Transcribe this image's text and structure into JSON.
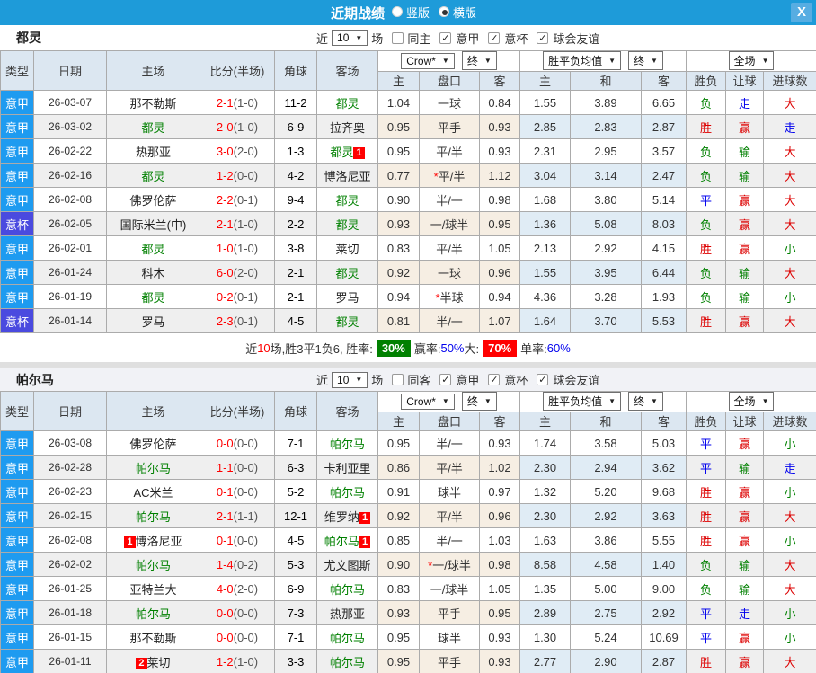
{
  "titlebar": {
    "title": "近期战绩",
    "radios": [
      {
        "label": "竖版",
        "checked": false
      },
      {
        "label": "横版",
        "checked": true
      }
    ],
    "close_label": "X"
  },
  "colors": {
    "titlebar_bg": "#1E9BD9",
    "league_badge": "#1E9BF0",
    "cup_badge": "#4A4ADF",
    "self_team": "#008000",
    "win": "#DD0000",
    "draw": "#0000EE",
    "loss": "#008000",
    "win_rate_bg": "#008000",
    "big_rate_bg": "#FF0000"
  },
  "table_headers": {
    "cols": [
      "类型",
      "日期",
      "主场",
      "比分(半场)",
      "角球",
      "客场"
    ],
    "sub_odds": [
      "主",
      "盘口",
      "客"
    ],
    "sub_mean": [
      "主",
      "和",
      "客"
    ],
    "sub_result": [
      "胜负",
      "让球",
      "进球数"
    ]
  },
  "sections": [
    {
      "team": "都灵",
      "filter": {
        "prefix": "近",
        "count": "10",
        "suffix": "场",
        "same_label": "同主",
        "same_checked": false,
        "competitions": [
          {
            "label": "意甲",
            "checked": true
          },
          {
            "label": "意杯",
            "checked": true
          },
          {
            "label": "球会友谊",
            "checked": true
          }
        ]
      },
      "dropdowns": {
        "company": "Crow*",
        "company_state": "终",
        "mean": "胜平负均值",
        "mean_state": "终",
        "scope": "全场"
      },
      "rows": [
        {
          "t": "意甲",
          "tc": "league",
          "d": "26-03-07",
          "hp": "",
          "h": "那不勒斯",
          "hs": false,
          "hb": "",
          "s": "2-1",
          "sh": "(1-0)",
          "ck": "11-2",
          "ap": "",
          "a": "都灵",
          "as": true,
          "ab": "",
          "o1": "1.04",
          "st": false,
          "hc": "一球",
          "o2": "0.84",
          "m1": "1.55",
          "m2": "3.89",
          "m3": "6.65",
          "r": [
            "负",
            "g"
          ],
          "l": [
            "走",
            "b"
          ],
          "g": [
            "大",
            "r"
          ]
        },
        {
          "t": "意甲",
          "tc": "league",
          "d": "26-03-02",
          "hp": "",
          "h": "都灵",
          "hs": true,
          "hb": "",
          "s": "2-0",
          "sh": "(1-0)",
          "ck": "6-9",
          "ap": "",
          "a": "拉齐奥",
          "as": false,
          "ab": "",
          "o1": "0.95",
          "st": false,
          "hc": "平手",
          "o2": "0.93",
          "m1": "2.85",
          "m2": "2.83",
          "m3": "2.87",
          "r": [
            "胜",
            "r"
          ],
          "l": [
            "赢",
            "r"
          ],
          "g": [
            "走",
            "b"
          ]
        },
        {
          "t": "意甲",
          "tc": "league",
          "d": "26-02-22",
          "hp": "",
          "h": "热那亚",
          "hs": false,
          "hb": "",
          "s": "3-0",
          "sh": "(2-0)",
          "ck": "1-3",
          "ap": "",
          "a": "都灵",
          "as": true,
          "ab": "1",
          "o1": "0.95",
          "st": false,
          "hc": "平/半",
          "o2": "0.93",
          "m1": "2.31",
          "m2": "2.95",
          "m3": "3.57",
          "r": [
            "负",
            "g"
          ],
          "l": [
            "输",
            "g"
          ],
          "g": [
            "大",
            "r"
          ]
        },
        {
          "t": "意甲",
          "tc": "league",
          "d": "26-02-16",
          "hp": "",
          "h": "都灵",
          "hs": true,
          "hb": "",
          "s": "1-2",
          "sh": "(0-0)",
          "ck": "4-2",
          "ap": "",
          "a": "博洛尼亚",
          "as": false,
          "ab": "",
          "o1": "0.77",
          "st": true,
          "hc": "平/半",
          "o2": "1.12",
          "m1": "3.04",
          "m2": "3.14",
          "m3": "2.47",
          "r": [
            "负",
            "g"
          ],
          "l": [
            "输",
            "g"
          ],
          "g": [
            "大",
            "r"
          ]
        },
        {
          "t": "意甲",
          "tc": "league",
          "d": "26-02-08",
          "hp": "",
          "h": "佛罗伦萨",
          "hs": false,
          "hb": "",
          "s": "2-2",
          "sh": "(0-1)",
          "ck": "9-4",
          "ap": "",
          "a": "都灵",
          "as": true,
          "ab": "",
          "o1": "0.90",
          "st": false,
          "hc": "半/一",
          "o2": "0.98",
          "m1": "1.68",
          "m2": "3.80",
          "m3": "5.14",
          "r": [
            "平",
            "b"
          ],
          "l": [
            "赢",
            "r"
          ],
          "g": [
            "大",
            "r"
          ]
        },
        {
          "t": "意杯",
          "tc": "cup",
          "d": "26-02-05",
          "hp": "",
          "h": "国际米兰(中)",
          "hs": false,
          "hb": "",
          "s": "2-1",
          "sh": "(1-0)",
          "ck": "2-2",
          "ap": "",
          "a": "都灵",
          "as": true,
          "ab": "",
          "o1": "0.93",
          "st": false,
          "hc": "一/球半",
          "o2": "0.95",
          "m1": "1.36",
          "m2": "5.08",
          "m3": "8.03",
          "r": [
            "负",
            "g"
          ],
          "l": [
            "赢",
            "r"
          ],
          "g": [
            "大",
            "r"
          ]
        },
        {
          "t": "意甲",
          "tc": "league",
          "d": "26-02-01",
          "hp": "",
          "h": "都灵",
          "hs": true,
          "hb": "",
          "s": "1-0",
          "sh": "(1-0)",
          "ck": "3-8",
          "ap": "",
          "a": "莱切",
          "as": false,
          "ab": "",
          "o1": "0.83",
          "st": false,
          "hc": "平/半",
          "o2": "1.05",
          "m1": "2.13",
          "m2": "2.92",
          "m3": "4.15",
          "r": [
            "胜",
            "r"
          ],
          "l": [
            "赢",
            "r"
          ],
          "g": [
            "小",
            "g"
          ]
        },
        {
          "t": "意甲",
          "tc": "league",
          "d": "26-01-24",
          "hp": "",
          "h": "科木",
          "hs": false,
          "hb": "",
          "s": "6-0",
          "sh": "(2-0)",
          "ck": "2-1",
          "ap": "",
          "a": "都灵",
          "as": true,
          "ab": "",
          "o1": "0.92",
          "st": false,
          "hc": "一球",
          "o2": "0.96",
          "m1": "1.55",
          "m2": "3.95",
          "m3": "6.44",
          "r": [
            "负",
            "g"
          ],
          "l": [
            "输",
            "g"
          ],
          "g": [
            "大",
            "r"
          ]
        },
        {
          "t": "意甲",
          "tc": "league",
          "d": "26-01-19",
          "hp": "",
          "h": "都灵",
          "hs": true,
          "hb": "",
          "s": "0-2",
          "sh": "(0-1)",
          "ck": "2-1",
          "ap": "",
          "a": "罗马",
          "as": false,
          "ab": "",
          "o1": "0.94",
          "st": true,
          "hc": "半球",
          "o2": "0.94",
          "m1": "4.36",
          "m2": "3.28",
          "m3": "1.93",
          "r": [
            "负",
            "g"
          ],
          "l": [
            "输",
            "g"
          ],
          "g": [
            "小",
            "g"
          ]
        },
        {
          "t": "意杯",
          "tc": "cup",
          "d": "26-01-14",
          "hp": "",
          "h": "罗马",
          "hs": false,
          "hb": "",
          "s": "2-3",
          "sh": "(0-1)",
          "ck": "4-5",
          "ap": "",
          "a": "都灵",
          "as": true,
          "ab": "",
          "o1": "0.81",
          "st": false,
          "hc": "半/一",
          "o2": "1.07",
          "m1": "1.64",
          "m2": "3.70",
          "m3": "5.53",
          "r": [
            "胜",
            "r"
          ],
          "l": [
            "赢",
            "r"
          ],
          "g": [
            "大",
            "r"
          ]
        }
      ],
      "summary": [
        {
          "t": "近",
          "c": "k"
        },
        {
          "t": "10",
          "c": "r"
        },
        {
          "t": "场,胜3平1负6, 胜率:",
          "c": "k"
        },
        {
          "t": "30%",
          "c": "wg"
        },
        {
          "t": "赢率:",
          "c": "k"
        },
        {
          "t": "50%",
          "c": "b"
        },
        {
          "t": " 大:",
          "c": "k"
        },
        {
          "t": "70%",
          "c": "wr"
        },
        {
          "t": "单率:",
          "c": "k"
        },
        {
          "t": "60%",
          "c": "b"
        }
      ]
    },
    {
      "team": "帕尔马",
      "filter": {
        "prefix": "近",
        "count": "10",
        "suffix": "场",
        "same_label": "同客",
        "same_checked": false,
        "competitions": [
          {
            "label": "意甲",
            "checked": true
          },
          {
            "label": "意杯",
            "checked": true
          },
          {
            "label": "球会友谊",
            "checked": true
          }
        ]
      },
      "dropdowns": {
        "company": "Crow*",
        "company_state": "终",
        "mean": "胜平负均值",
        "mean_state": "终",
        "scope": "全场"
      },
      "rows": [
        {
          "t": "意甲",
          "tc": "league",
          "d": "26-03-08",
          "hp": "",
          "h": "佛罗伦萨",
          "hs": false,
          "hb": "",
          "s": "0-0",
          "sh": "(0-0)",
          "ck": "7-1",
          "ap": "",
          "a": "帕尔马",
          "as": true,
          "ab": "",
          "o1": "0.95",
          "st": false,
          "hc": "半/一",
          "o2": "0.93",
          "m1": "1.74",
          "m2": "3.58",
          "m3": "5.03",
          "r": [
            "平",
            "b"
          ],
          "l": [
            "赢",
            "r"
          ],
          "g": [
            "小",
            "g"
          ]
        },
        {
          "t": "意甲",
          "tc": "league",
          "d": "26-02-28",
          "hp": "",
          "h": "帕尔马",
          "hs": true,
          "hb": "",
          "s": "1-1",
          "sh": "(0-0)",
          "ck": "6-3",
          "ap": "",
          "a": "卡利亚里",
          "as": false,
          "ab": "",
          "o1": "0.86",
          "st": false,
          "hc": "平/半",
          "o2": "1.02",
          "m1": "2.30",
          "m2": "2.94",
          "m3": "3.62",
          "r": [
            "平",
            "b"
          ],
          "l": [
            "输",
            "g"
          ],
          "g": [
            "走",
            "b"
          ]
        },
        {
          "t": "意甲",
          "tc": "league",
          "d": "26-02-23",
          "hp": "",
          "h": "AC米兰",
          "hs": false,
          "hb": "",
          "s": "0-1",
          "sh": "(0-0)",
          "ck": "5-2",
          "ap": "",
          "a": "帕尔马",
          "as": true,
          "ab": "",
          "o1": "0.91",
          "st": false,
          "hc": "球半",
          "o2": "0.97",
          "m1": "1.32",
          "m2": "5.20",
          "m3": "9.68",
          "r": [
            "胜",
            "r"
          ],
          "l": [
            "赢",
            "r"
          ],
          "g": [
            "小",
            "g"
          ]
        },
        {
          "t": "意甲",
          "tc": "league",
          "d": "26-02-15",
          "hp": "",
          "h": "帕尔马",
          "hs": true,
          "hb": "",
          "s": "2-1",
          "sh": "(1-1)",
          "ck": "12-1",
          "ap": "",
          "a": "维罗纳",
          "as": false,
          "ab": "1",
          "o1": "0.92",
          "st": false,
          "hc": "平/半",
          "o2": "0.96",
          "m1": "2.30",
          "m2": "2.92",
          "m3": "3.63",
          "r": [
            "胜",
            "r"
          ],
          "l": [
            "赢",
            "r"
          ],
          "g": [
            "大",
            "r"
          ]
        },
        {
          "t": "意甲",
          "tc": "league",
          "d": "26-02-08",
          "hp": "1",
          "h": "博洛尼亚",
          "hs": false,
          "hb": "",
          "s": "0-1",
          "sh": "(0-0)",
          "ck": "4-5",
          "ap": "",
          "a": "帕尔马",
          "as": true,
          "ab": "1",
          "o1": "0.85",
          "st": false,
          "hc": "半/一",
          "o2": "1.03",
          "m1": "1.63",
          "m2": "3.86",
          "m3": "5.55",
          "r": [
            "胜",
            "r"
          ],
          "l": [
            "赢",
            "r"
          ],
          "g": [
            "小",
            "g"
          ]
        },
        {
          "t": "意甲",
          "tc": "league",
          "d": "26-02-02",
          "hp": "",
          "h": "帕尔马",
          "hs": true,
          "hb": "",
          "s": "1-4",
          "sh": "(0-2)",
          "ck": "5-3",
          "ap": "",
          "a": "尤文图斯",
          "as": false,
          "ab": "",
          "o1": "0.90",
          "st": true,
          "hc": "一/球半",
          "o2": "0.98",
          "m1": "8.58",
          "m2": "4.58",
          "m3": "1.40",
          "r": [
            "负",
            "g"
          ],
          "l": [
            "输",
            "g"
          ],
          "g": [
            "大",
            "r"
          ]
        },
        {
          "t": "意甲",
          "tc": "league",
          "d": "26-01-25",
          "hp": "",
          "h": "亚特兰大",
          "hs": false,
          "hb": "",
          "s": "4-0",
          "sh": "(2-0)",
          "ck": "6-9",
          "ap": "",
          "a": "帕尔马",
          "as": true,
          "ab": "",
          "o1": "0.83",
          "st": false,
          "hc": "一/球半",
          "o2": "1.05",
          "m1": "1.35",
          "m2": "5.00",
          "m3": "9.00",
          "r": [
            "负",
            "g"
          ],
          "l": [
            "输",
            "g"
          ],
          "g": [
            "大",
            "r"
          ]
        },
        {
          "t": "意甲",
          "tc": "league",
          "d": "26-01-18",
          "hp": "",
          "h": "帕尔马",
          "hs": true,
          "hb": "",
          "s": "0-0",
          "sh": "(0-0)",
          "ck": "7-3",
          "ap": "",
          "a": "热那亚",
          "as": false,
          "ab": "",
          "o1": "0.93",
          "st": false,
          "hc": "平手",
          "o2": "0.95",
          "m1": "2.89",
          "m2": "2.75",
          "m3": "2.92",
          "r": [
            "平",
            "b"
          ],
          "l": [
            "走",
            "b"
          ],
          "g": [
            "小",
            "g"
          ]
        },
        {
          "t": "意甲",
          "tc": "league",
          "d": "26-01-15",
          "hp": "",
          "h": "那不勒斯",
          "hs": false,
          "hb": "",
          "s": "0-0",
          "sh": "(0-0)",
          "ck": "7-1",
          "ap": "",
          "a": "帕尔马",
          "as": true,
          "ab": "",
          "o1": "0.95",
          "st": false,
          "hc": "球半",
          "o2": "0.93",
          "m1": "1.30",
          "m2": "5.24",
          "m3": "10.69",
          "r": [
            "平",
            "b"
          ],
          "l": [
            "赢",
            "r"
          ],
          "g": [
            "小",
            "g"
          ]
        },
        {
          "t": "意甲",
          "tc": "league",
          "d": "26-01-11",
          "hp": "2",
          "h": "莱切",
          "hs": false,
          "hb": "",
          "s": "1-2",
          "sh": "(1-0)",
          "ck": "3-3",
          "ap": "",
          "a": "帕尔马",
          "as": true,
          "ab": "",
          "o1": "0.95",
          "st": false,
          "hc": "平手",
          "o2": "0.93",
          "m1": "2.77",
          "m2": "2.90",
          "m3": "2.87",
          "r": [
            "胜",
            "r"
          ],
          "l": [
            "赢",
            "r"
          ],
          "g": [
            "大",
            "r"
          ]
        }
      ],
      "summary": null
    }
  ]
}
